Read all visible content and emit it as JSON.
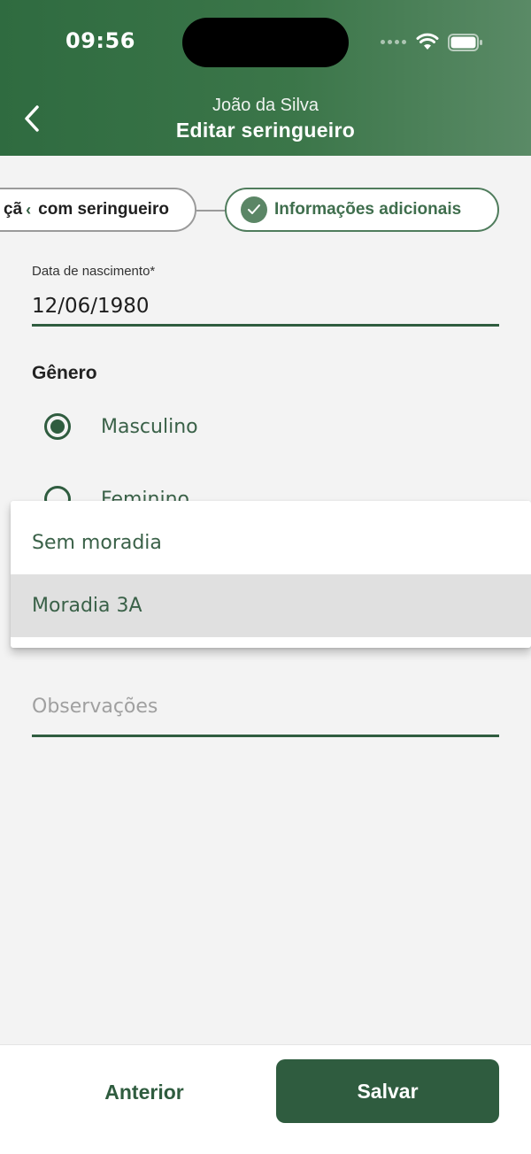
{
  "status_bar": {
    "time": "09:56"
  },
  "header": {
    "subtitle": "João da Silva",
    "title": "Editar seringueiro",
    "back_icon": "chevron-left-icon"
  },
  "stepper": {
    "previous_step_label": "çã",
    "previous_step_label_tail": "com seringueiro",
    "current_step_label": "Informações adicionais"
  },
  "form": {
    "birth_date": {
      "label": "Data de nascimento*",
      "value": "12/06/1980"
    },
    "gender": {
      "title": "Gênero",
      "options": [
        {
          "label": "Masculino",
          "selected": true
        },
        {
          "label": "Feminino",
          "selected": false
        }
      ]
    },
    "notes": {
      "placeholder": "Observações",
      "value": ""
    }
  },
  "dropdown": {
    "options": [
      {
        "label": "Sem moradia",
        "selected": false
      },
      {
        "label": "Moradia 3A",
        "selected": true
      }
    ]
  },
  "footer": {
    "previous_label": "Anterior",
    "save_label": "Salvar"
  },
  "colors": {
    "primary": "#2f5c3f",
    "header_gradient_start": "#2f6b40",
    "header_gradient_end": "#5a8a66",
    "background": "#f3f3f3",
    "selected_option_bg": "#e0e0e0"
  }
}
